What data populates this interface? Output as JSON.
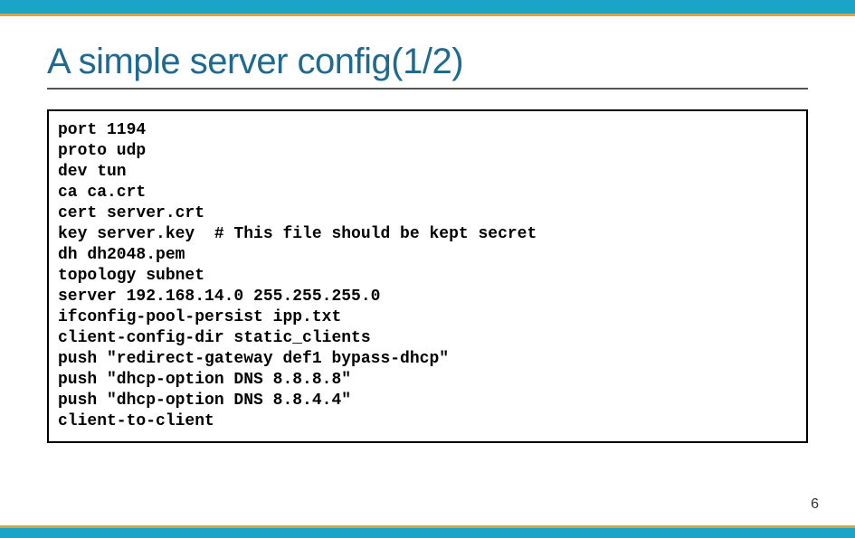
{
  "slide": {
    "title": "A simple server config(1/2)",
    "page_number": "6"
  },
  "code": {
    "lines": [
      "port 1194",
      "proto udp",
      "dev tun",
      "ca ca.crt",
      "cert server.crt",
      "key server.key  # This file should be kept secret",
      "dh dh2048.pem",
      "topology subnet",
      "server 192.168.14.0 255.255.255.0",
      "ifconfig-pool-persist ipp.txt",
      "client-config-dir static_clients",
      "push \"redirect-gateway def1 bypass-dhcp\"",
      "push \"dhcp-option DNS 8.8.8.8\"",
      "push \"dhcp-option DNS 8.8.4.4\"",
      "client-to-client"
    ]
  }
}
